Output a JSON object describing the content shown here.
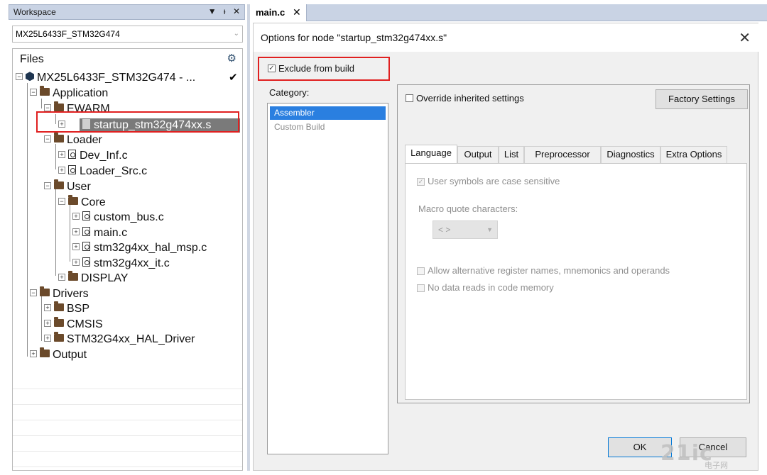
{
  "workspace": {
    "title": "Workspace",
    "controls": {
      "dropdown": "▼",
      "pin": "ᵻ",
      "close": "✕"
    },
    "project_combo_value": "MX25L6433F_STM32G474",
    "files_header": "Files",
    "tree": {
      "root": "MX25L6433F_STM32G474 - ...",
      "application": "Application",
      "ewarm": "EWARM",
      "startup_file": "startup_stm32g474xx.s",
      "loader": "Loader",
      "dev_inf": "Dev_Inf.c",
      "loader_src": "Loader_Src.c",
      "user": "User",
      "core": "Core",
      "custom_bus": "custom_bus.c",
      "main_c": "main.c",
      "hal_msp": "stm32g4xx_hal_msp.c",
      "it_c": "stm32g4xx_it.c",
      "display": "DISPLAY",
      "drivers": "Drivers",
      "bsp": "BSP",
      "cmsis": "CMSIS",
      "hal_driver": "STM32G4xx_HAL_Driver",
      "output": "Output"
    }
  },
  "editor": {
    "tab_label": "main.c",
    "tab_close": "✕"
  },
  "dialog": {
    "title": "Options for node \"startup_stm32g474xx.s\"",
    "close": "✕",
    "exclude_from_build": "Exclude from build",
    "category_label": "Category:",
    "categories": [
      "Assembler",
      "Custom Build"
    ],
    "override_label": "Override inherited settings",
    "factory_settings": "Factory Settings",
    "tabs": [
      "Language",
      "Output",
      "List",
      "Preprocessor",
      "Diagnostics",
      "Extra Options"
    ],
    "language": {
      "case_sensitive": "User symbols are case sensitive",
      "macro_quote_label": "Macro quote characters:",
      "macro_quote_value": "< >",
      "alt_register_names": "Allow alternative register names, mnemonics and operands",
      "no_data_reads": "No data reads in code memory"
    },
    "ok": "OK",
    "cancel": "Cancel"
  },
  "watermark": {
    "main": "21ic",
    "sub": "电子网"
  },
  "colors": {
    "selection_blue": "#2a7fe0",
    "highlight_red": "#e02020",
    "titlebar": "#c9d3e4",
    "folder_brown": "#6b4a2b"
  }
}
